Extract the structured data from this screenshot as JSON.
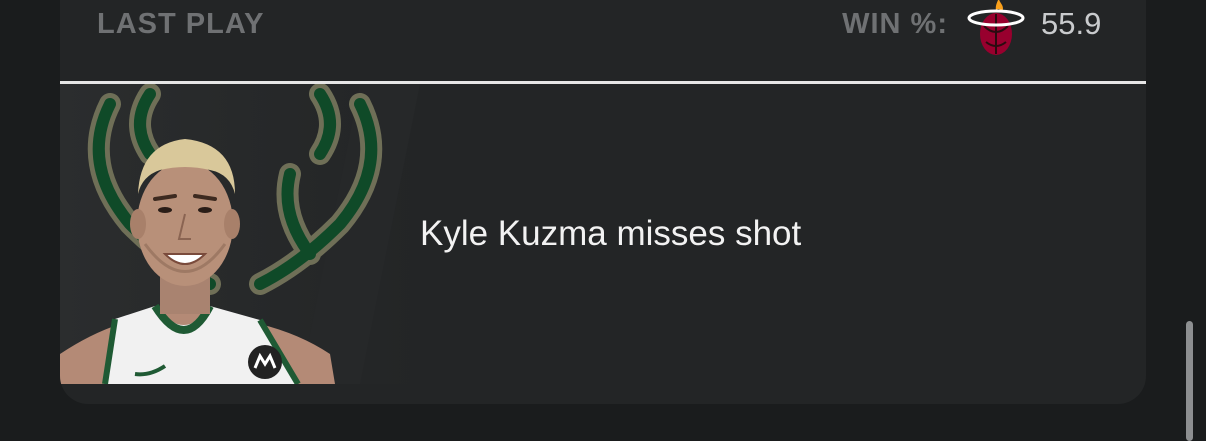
{
  "header": {
    "title": "LAST PLAY",
    "win_label": "WIN %:",
    "win_value": "55.9",
    "team_logo_icon": "miami-heat-logo-icon"
  },
  "play": {
    "description": "Kyle Kuzma misses shot",
    "player_image": "player-headshot",
    "team_bg_icon": "milwaukee-bucks-antlers-icon"
  },
  "colors": {
    "background": "#1a1c1d",
    "card": "#232526",
    "header_label": "#6f7173",
    "divider": "#e6e6e6",
    "bucks_green": "#00471b",
    "heat_red": "#98002e"
  }
}
